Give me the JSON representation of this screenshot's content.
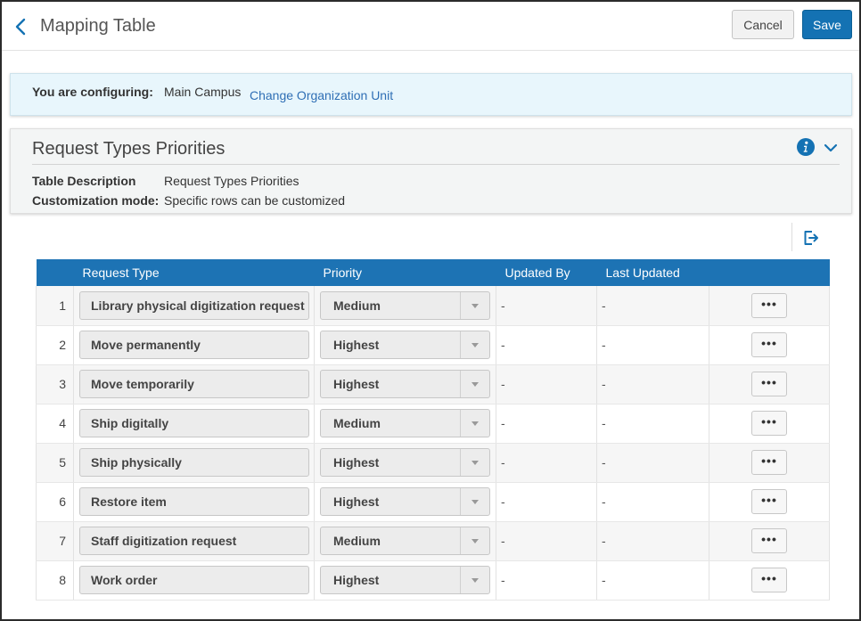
{
  "header": {
    "title": "Mapping Table",
    "cancel_label": "Cancel",
    "save_label": "Save"
  },
  "config": {
    "label": "You are configuring:",
    "value": "Main Campus",
    "link": "Change Organization Unit"
  },
  "panel": {
    "title": "Request Types Priorities",
    "rows": [
      {
        "key": "Table Description",
        "value": "Request Types Priorities"
      },
      {
        "key": "Customization mode:",
        "value": "Specific rows can be customized"
      }
    ]
  },
  "table": {
    "columns": [
      "Request Type",
      "Priority",
      "Updated By",
      "Last Updated"
    ],
    "rows": [
      {
        "num": "1",
        "request_type": "Library physical digitization request",
        "priority": "Medium",
        "updated_by": "-",
        "last_updated": "-"
      },
      {
        "num": "2",
        "request_type": "Move permanently",
        "priority": "Highest",
        "updated_by": "-",
        "last_updated": "-"
      },
      {
        "num": "3",
        "request_type": "Move temporarily",
        "priority": "Highest",
        "updated_by": "-",
        "last_updated": "-"
      },
      {
        "num": "4",
        "request_type": "Ship digitally",
        "priority": "Medium",
        "updated_by": "-",
        "last_updated": "-"
      },
      {
        "num": "5",
        "request_type": "Ship physically",
        "priority": "Highest",
        "updated_by": "-",
        "last_updated": "-"
      },
      {
        "num": "6",
        "request_type": "Restore item",
        "priority": "Highest",
        "updated_by": "-",
        "last_updated": "-"
      },
      {
        "num": "7",
        "request_type": "Staff digitization request",
        "priority": "Medium",
        "updated_by": "-",
        "last_updated": "-"
      },
      {
        "num": "8",
        "request_type": "Work order",
        "priority": "Highest",
        "updated_by": "-",
        "last_updated": "-"
      }
    ],
    "row_action_label": "•••"
  },
  "icons": {
    "back": "chevron-left-icon",
    "info": "info-icon",
    "collapse": "chevron-down-icon",
    "export": "export-icon",
    "dropdown": "caret-down-icon"
  },
  "colors": {
    "accent": "#1472b3",
    "table_header": "#1d73b4",
    "config_bg": "#e8f6fc",
    "link": "#2f6fb5"
  }
}
